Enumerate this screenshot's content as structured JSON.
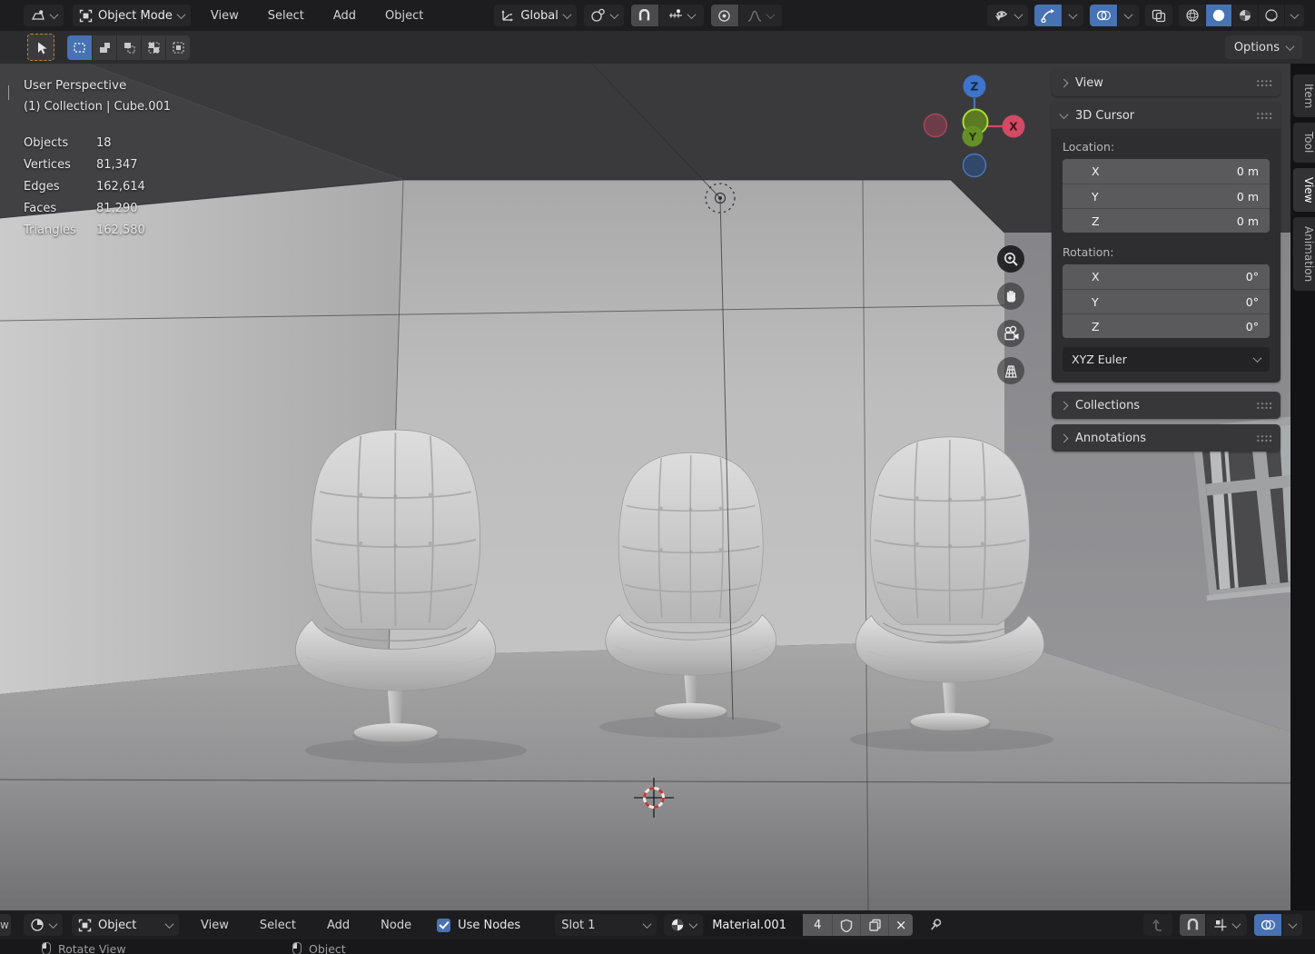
{
  "topbar": {
    "mode": "Object Mode",
    "menus": [
      "View",
      "Select",
      "Add",
      "Object"
    ],
    "orientation": "Global"
  },
  "toolrow": {
    "options": "Options"
  },
  "viewport_overlay": {
    "view_name": "User Perspective",
    "context": "(1) Collection | Cube.001",
    "stats": [
      {
        "label": "Objects",
        "value": "18"
      },
      {
        "label": "Vertices",
        "value": "81,347"
      },
      {
        "label": "Edges",
        "value": "162,614"
      },
      {
        "label": "Faces",
        "value": "81,290"
      },
      {
        "label": "Triangles",
        "value": "162,580"
      }
    ]
  },
  "gizmo": {
    "x": "X",
    "y": "Y",
    "z": "Z"
  },
  "sidebar": {
    "tabs": [
      "Item",
      "Tool",
      "View",
      "Animation"
    ],
    "active_tab": "View",
    "panels": {
      "view": "View",
      "cursor": "3D Cursor",
      "collections": "Collections",
      "annotations": "Annotations"
    },
    "cursor": {
      "location_label": "Location:",
      "rotation_label": "Rotation:",
      "loc": [
        {
          "axis": "X",
          "value": "0 m"
        },
        {
          "axis": "Y",
          "value": "0 m"
        },
        {
          "axis": "Z",
          "value": "0 m"
        }
      ],
      "rot": [
        {
          "axis": "X",
          "value": "0°"
        },
        {
          "axis": "Y",
          "value": "0°"
        },
        {
          "axis": "Z",
          "value": "0°"
        }
      ],
      "euler": "XYZ Euler"
    }
  },
  "bottombar": {
    "mode": "Object",
    "menus": [
      "View",
      "Select",
      "Add",
      "Node"
    ],
    "use_nodes": "Use Nodes",
    "slot": "Slot 1",
    "material_name": "Material.001",
    "users_count": "4",
    "unlink": "×"
  },
  "statusbar": {
    "left": "Rotate View",
    "middle": "Object",
    "edge_fragment": "w"
  },
  "icons": {
    "editor_3d": "3d-viewport-icon",
    "editor_shader": "shader-editor-icon",
    "snap": "magnet-icon",
    "proportional": "dot-circle-icon",
    "overlays": "two-circles-icon",
    "gizmos": "arc-arrow-icon",
    "xray": "two-squares-icon",
    "shading": [
      "wireframe-sphere",
      "solid-sphere",
      "material-sphere",
      "rendered-sphere"
    ]
  },
  "colors": {
    "accent": "#4772b3",
    "axis_x": "#d24a63",
    "axis_y": "#6f9d2b",
    "axis_z": "#3e74c9",
    "cursor_red": "#c23a34"
  }
}
